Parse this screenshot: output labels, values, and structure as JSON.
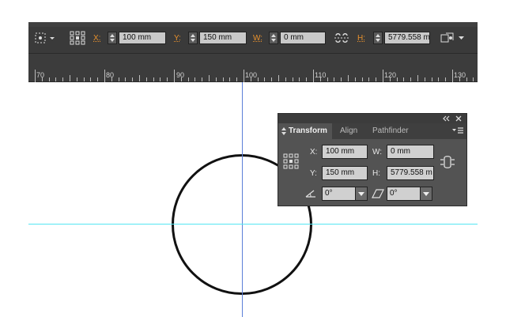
{
  "control_bar": {
    "x": {
      "label": "X:",
      "value": "100 mm"
    },
    "y": {
      "label": "Y:",
      "value": "150 mm"
    },
    "w": {
      "label": "W:",
      "value": "0 mm"
    },
    "h": {
      "label": "H:",
      "value": "5779.558 m"
    },
    "icons": [
      "selection-tool-icon",
      "reference-point-icon",
      "constrain-proportions-icon",
      "transform-options-icon"
    ]
  },
  "ruler": {
    "labels": [
      "70",
      "80",
      "90",
      "100",
      "110",
      "120",
      "130"
    ]
  },
  "transform_panel": {
    "tabs": [
      {
        "label": "Transform",
        "active": true
      },
      {
        "label": "Align",
        "active": false
      },
      {
        "label": "Pathfinder",
        "active": false
      }
    ],
    "x": {
      "label": "X:",
      "value": "100 mm"
    },
    "y": {
      "label": "Y:",
      "value": "150 mm"
    },
    "w": {
      "label": "W:",
      "value": "0 mm"
    },
    "h": {
      "label": "H:",
      "value": "5779.558 m"
    },
    "rotate": {
      "value": "0°"
    },
    "shear": {
      "value": "0°"
    }
  },
  "colors": {
    "accent_label": "#e8912d",
    "vertical_guide": "#5b7fd8",
    "horizontal_guide": "#55e6f2"
  }
}
